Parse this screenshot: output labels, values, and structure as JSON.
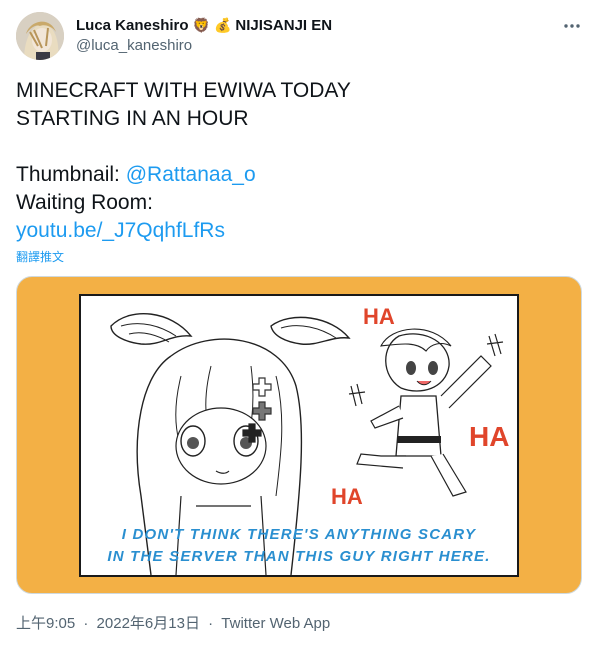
{
  "author": {
    "display_name": "Luca Kaneshiro",
    "emoji_1": "🦁",
    "emoji_2": "💰",
    "org": "NIJISANJI EN",
    "handle": "@luca_kaneshiro"
  },
  "tweet": {
    "line_1": "MINECRAFT WITH EWIWA TODAY",
    "line_2": "STARTING IN AN HOUR",
    "thumbnail_label": "Thumbnail: ",
    "thumbnail_mention": "@Rattanaa_o",
    "waiting_room_label": "Waiting Room:",
    "waiting_room_link": "youtu.be/_J7QqhfLfRs",
    "translate_label": "翻譯推文"
  },
  "media": {
    "caption_line_1": "I DON'T THINK THERE'S ANYTHING SCARY",
    "caption_line_2": "IN THE SERVER THAN THIS GUY RIGHT HERE.",
    "sfx": [
      "HA",
      "HA",
      "HA"
    ],
    "background_color": "#f3b045",
    "caption_color": "#2a8fd0",
    "sfx_color": "#e0452b"
  },
  "meta": {
    "time": "上午9:05",
    "separator": "·",
    "date": "2022年6月13日",
    "source": "Twitter Web App"
  },
  "colors": {
    "link": "#1d9bf0",
    "secondary_text": "#536471",
    "primary_text": "#0f1419"
  }
}
